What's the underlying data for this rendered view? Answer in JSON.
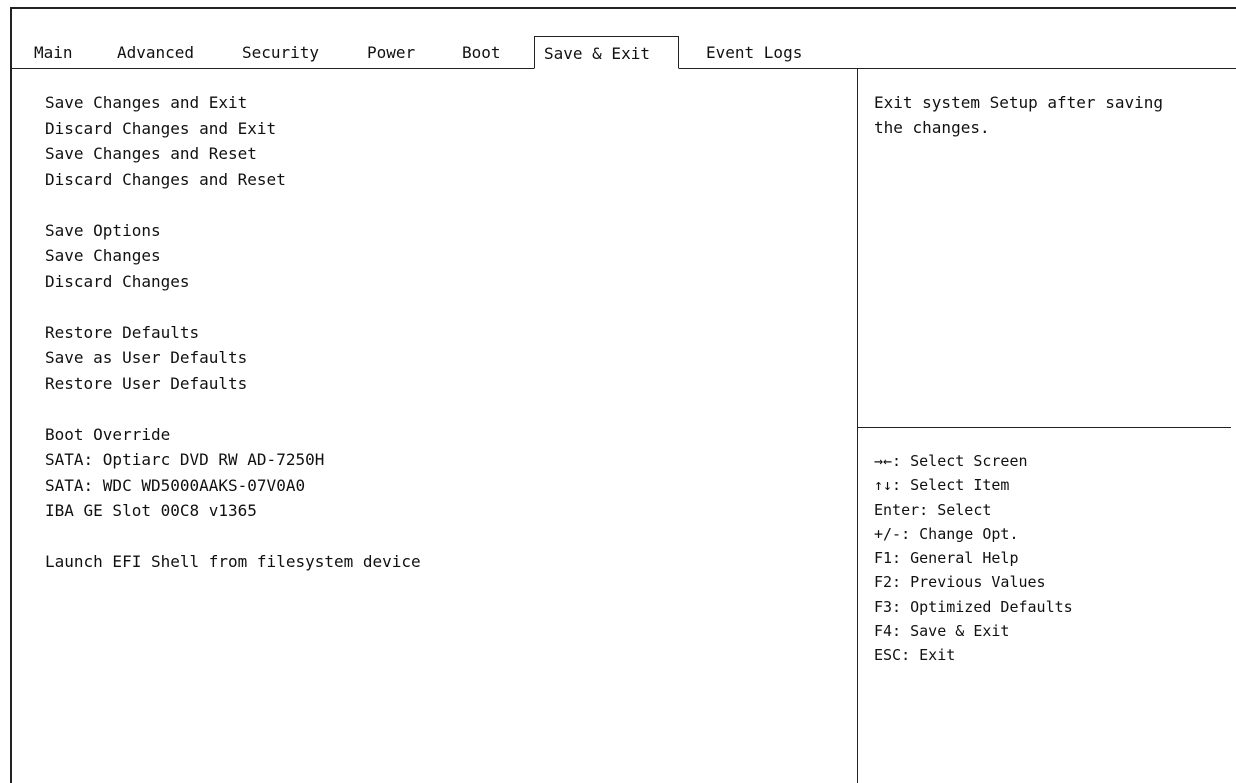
{
  "tabs": [
    {
      "label": "Main"
    },
    {
      "label": "Advanced"
    },
    {
      "label": "Security"
    },
    {
      "label": "Power"
    },
    {
      "label": "Boot"
    },
    {
      "label": "Save & Exit",
      "active": true
    },
    {
      "label": "Event Logs"
    }
  ],
  "menu": {
    "save_changes_and_exit": "Save Changes and Exit",
    "discard_changes_and_exit": "Discard Changes and Exit",
    "save_changes_and_reset": "Save Changes and Reset",
    "discard_changes_and_reset": "Discard Changes and Reset",
    "save_options": "Save Options",
    "save_changes": "Save Changes",
    "discard_changes": "Discard Changes",
    "restore_defaults": "Restore Defaults",
    "save_as_user_defaults": "Save as User Defaults",
    "restore_user_defaults": "Restore User Defaults",
    "boot_override": "Boot Override",
    "boot_dvd": "SATA: Optiarc DVD RW AD-7250H",
    "boot_hdd": "SATA: WDC WD5000AAKS-07V0A0",
    "boot_iba": "IBA GE Slot 00C8 v1365",
    "launch_efi_shell": "Launch EFI Shell from filesystem device"
  },
  "help": {
    "line1": "Exit system Setup after saving",
    "line2": "the changes."
  },
  "keys": [
    "→←: Select Screen",
    "↑↓: Select Item",
    "Enter: Select",
    "+/-: Change Opt.",
    "F1: General Help",
    "F2: Previous Values",
    "F3: Optimized Defaults",
    "F4: Save & Exit",
    "ESC: Exit"
  ]
}
